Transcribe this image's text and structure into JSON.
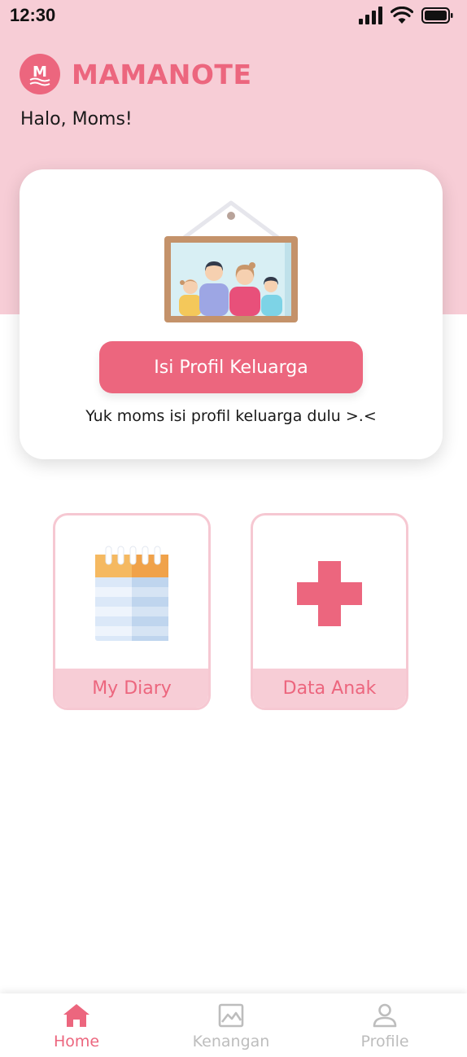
{
  "status_bar": {
    "time": "12:30",
    "icons": [
      "signal-icon",
      "wifi-icon",
      "battery-icon"
    ]
  },
  "header": {
    "logo_letter": "M",
    "app_name": "MAMANOTE",
    "greeting": "Halo, Moms!"
  },
  "profile_card": {
    "illustration": "family-photo-frame",
    "button_label": "Isi Profil Keluarga",
    "hint": "Yuk moms isi profil keluarga dulu >.<"
  },
  "menu": [
    {
      "label": "My Diary",
      "icon": "notebook-icon"
    },
    {
      "label": "Data Anak",
      "icon": "medical-cross-icon"
    }
  ],
  "bottom_nav": [
    {
      "label": "Home",
      "icon": "home-icon",
      "active": true
    },
    {
      "label": "Kenangan",
      "icon": "gallery-icon",
      "active": false
    },
    {
      "label": "Profile",
      "icon": "user-icon",
      "active": false
    }
  ],
  "colors": {
    "accent": "#ec667e",
    "hero_bg": "#f7cdd6",
    "inactive": "#bdbdbd"
  }
}
